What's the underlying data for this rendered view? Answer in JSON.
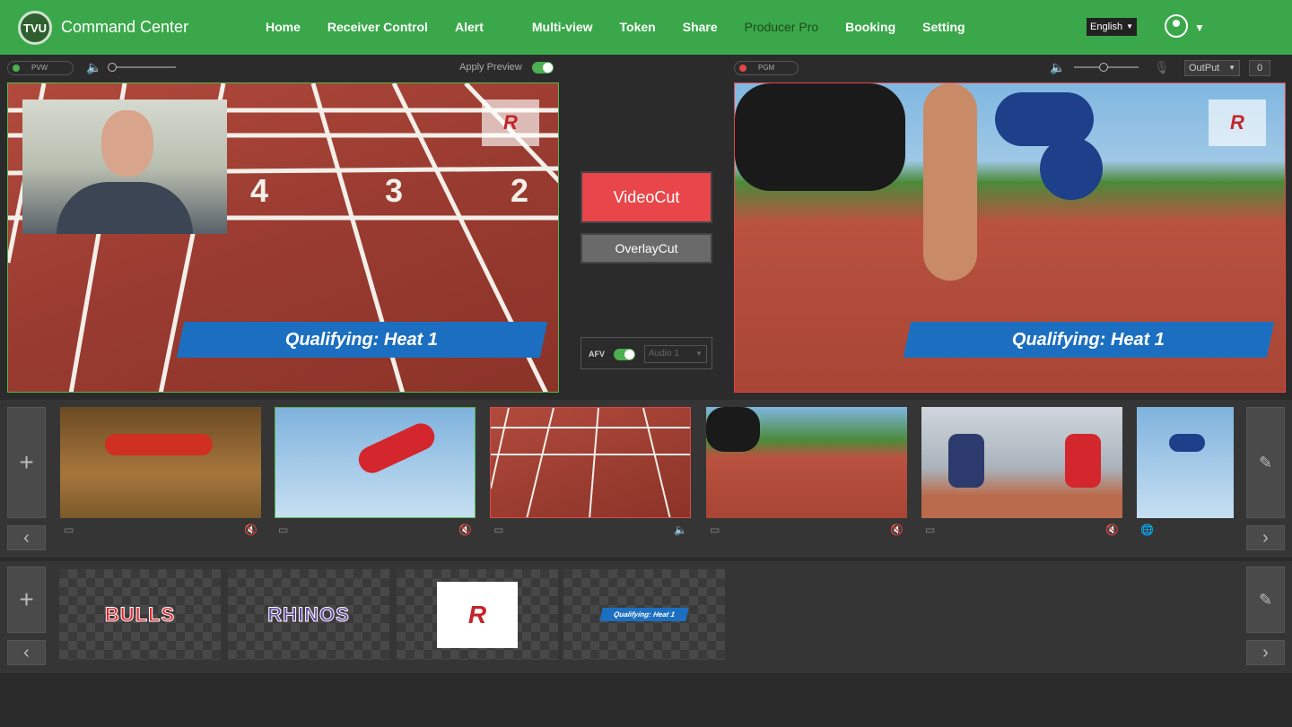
{
  "app": {
    "logo_text": "TVU",
    "title": "Command Center"
  },
  "nav": [
    "Home",
    "Receiver Control",
    "Alert",
    "Multi-view",
    "Token",
    "Share",
    "Producer Pro",
    "Booking",
    "Setting"
  ],
  "nav_active": "Producer Pro",
  "language": "English",
  "preview": {
    "badge": "PVW",
    "apply_preview_label": "Apply Preview",
    "apply_preview_on": true,
    "volume": 0.0,
    "lower_third": "Qualifying: Heat 1"
  },
  "program": {
    "badge": "PGM",
    "output_label": "OutPut",
    "counter": "0",
    "volume": 0.45,
    "lower_third": "Qualifying: Heat 1"
  },
  "controls": {
    "videocut": "VideoCut",
    "overlaycut": "OverlayCut",
    "afv_label": "AFV",
    "afv_on": true,
    "audio_select": "Audio 1"
  },
  "overlays": {
    "bulls": "BULLS",
    "rhinos": "RHINOS",
    "lower_third": "Qualifying: Heat 1"
  },
  "icons": {
    "add": "+",
    "prev": "‹",
    "next": "›",
    "clear": "✎"
  },
  "colors": {
    "accent": "#3aa84a",
    "pgm": "#e04848",
    "pvw": "#56b84f",
    "cut": "#e8464a",
    "banner": "#1c6fc0"
  }
}
